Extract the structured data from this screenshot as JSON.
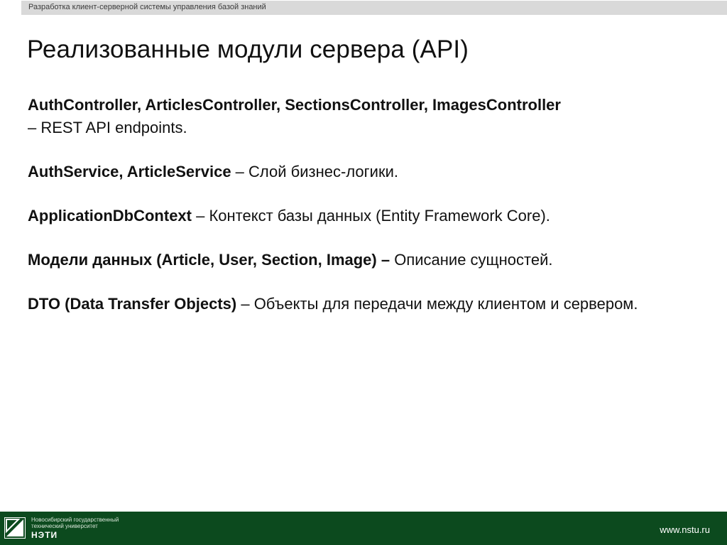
{
  "header": {
    "topbar_text": "Разработка клиент-серверной системы управления базой знаний"
  },
  "slide": {
    "title": "Реализованные модули сервера (API)",
    "items": [
      {
        "bold": "AuthController, ArticlesController, SectionsController, ImagesController",
        "text": " – REST API endpoints.",
        "break_after_bold": true
      },
      {
        "bold": "AuthService, ArticleService",
        "text": " – Слой бизнес-логики."
      },
      {
        "bold": "ApplicationDbContext",
        "text": " – Контекст базы данных (Entity Framework Core)."
      },
      {
        "bold": "Модели данных (Article, User, Section, Image) –",
        "text": " Описание сущностей."
      },
      {
        "bold": "DTO (Data Transfer Objects)",
        "text": " – Объекты для передачи между клиентом и сервером."
      }
    ]
  },
  "footer": {
    "logo_line1": "Новосибирский государственный",
    "logo_line2": "технический университет",
    "logo_name": "НЭТИ",
    "website": "www.nstu.ru",
    "colors": {
      "bar": "#0c4a1e",
      "topbar": "#d9d9d9"
    }
  }
}
